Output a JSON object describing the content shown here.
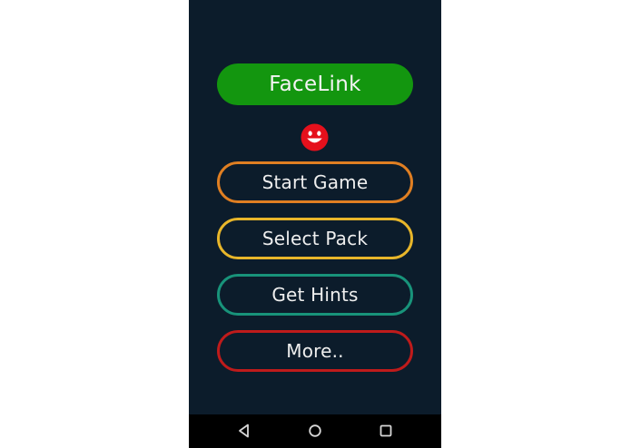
{
  "app": {
    "title": "FaceLink"
  },
  "menu": {
    "start_game": "Start Game",
    "select_pack": "Select Pack",
    "get_hints": "Get Hints",
    "more": "More.."
  },
  "colors": {
    "background": "#0c1c2b",
    "title_pill": "#13960f",
    "start_game_border": "#e07f22",
    "select_pack_border": "#e8b62a",
    "get_hints_border": "#18937a",
    "more_border": "#bf1b1b",
    "smiley": "#e5101c",
    "navbar": "#000000"
  },
  "icons": {
    "logo": "smiley-icon",
    "nav_back": "back-triangle-icon",
    "nav_home": "home-circle-icon",
    "nav_recents": "recents-square-icon"
  }
}
